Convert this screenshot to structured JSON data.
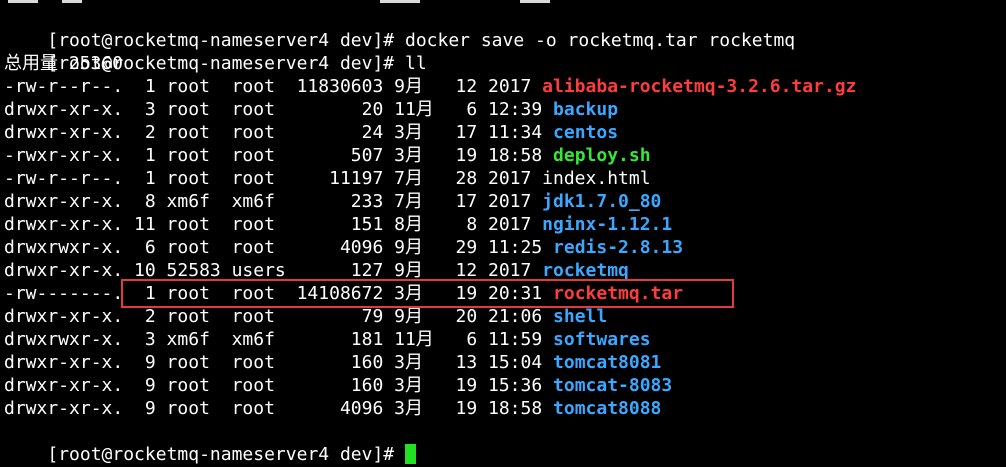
{
  "colors": {
    "background": "#000000",
    "text": "#ffffff",
    "archive": "#ff3c3c",
    "directory": "#3ba7ff",
    "executable": "#35e835",
    "cursor": "#22e022",
    "highlight_box": "#e23b3b"
  },
  "commands": [
    {
      "prompt": "[root@rocketmq-nameserver4 dev]# ",
      "command": "docker save -o rocketmq.tar rocketmq"
    },
    {
      "prompt": "[root@rocketmq-nameserver4 dev]# ",
      "command": "ll"
    }
  ],
  "total_line": "总用量 25360",
  "listing": [
    {
      "meta": "-rw-r--r--.  1 root  root  11830603 9月   12 2017 ",
      "name": "alibaba-rocketmq-3.2.6.tar.gz",
      "kind": "archive"
    },
    {
      "meta": "drwxr-xr-x.  3 root  root        20 11月   6 12:39 ",
      "name": "backup",
      "kind": "directory"
    },
    {
      "meta": "drwxr-xr-x.  2 root  root        24 3月   17 11:34 ",
      "name": "centos",
      "kind": "directory"
    },
    {
      "meta": "-rwxr-xr-x.  1 root  root       507 3月   19 18:58 ",
      "name": "deploy.sh",
      "kind": "executable"
    },
    {
      "meta": "-rw-r--r--.  1 root  root     11197 7月   28 2017 ",
      "name": "index.html",
      "kind": "file"
    },
    {
      "meta": "drwxr-xr-x.  8 xm6f  xm6f       233 7月   17 2017 ",
      "name": "jdk1.7.0_80",
      "kind": "directory"
    },
    {
      "meta": "drwxr-xr-x. 11 root  root       151 8月    8 2017 ",
      "name": "nginx-1.12.1",
      "kind": "directory"
    },
    {
      "meta": "drwxrwxr-x.  6 root  root      4096 9月   29 11:25 ",
      "name": "redis-2.8.13",
      "kind": "directory"
    },
    {
      "meta": "drwxr-xr-x. 10 52583 users      127 9月   12 2017 ",
      "name": "rocketmq",
      "kind": "directory"
    },
    {
      "meta": "-rw-------.  1 root  root  14108672 3月   19 20:31 ",
      "name": "rocketmq.tar",
      "kind": "archive"
    },
    {
      "meta": "drwxr-xr-x.  2 root  root        79 9月   20 21:06 ",
      "name": "shell",
      "kind": "directory"
    },
    {
      "meta": "drwxrwxr-x.  3 xm6f  xm6f       181 11月   6 11:59 ",
      "name": "softwares",
      "kind": "directory"
    },
    {
      "meta": "drwxr-xr-x.  9 root  root       160 3月   13 15:04 ",
      "name": "tomcat8081",
      "kind": "directory"
    },
    {
      "meta": "drwxr-xr-x.  9 root  root       160 3月   19 15:36 ",
      "name": "tomcat-8083",
      "kind": "directory"
    },
    {
      "meta": "drwxr-xr-x.  9 root  root      4096 3月   19 18:58 ",
      "name": "tomcat8088",
      "kind": "directory"
    }
  ],
  "final_prompt": "[root@rocketmq-nameserver4 dev]# "
}
